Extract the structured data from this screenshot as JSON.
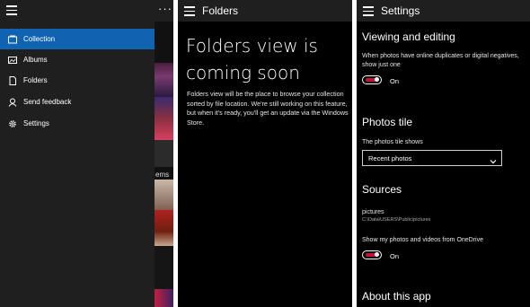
{
  "nav_panel": {
    "items": [
      {
        "label": "Collection",
        "icon": "collection-icon",
        "active": true
      },
      {
        "label": "Albums",
        "icon": "albums-icon",
        "active": false
      },
      {
        "label": "Folders",
        "icon": "folders-icon",
        "active": false
      },
      {
        "label": "Send feedback",
        "icon": "feedback-icon",
        "active": false
      },
      {
        "label": "Settings",
        "icon": "gear-icon",
        "active": false
      }
    ],
    "more_label": "···",
    "background_label": "ems",
    "accent_color": "#0f63b0"
  },
  "folders_panel": {
    "title": "Folders",
    "headline": "Folders view is coming soon",
    "description": "Folders view will be the place to browse your collection sorted by file location. We're still working on this feature, but when it's ready, you'll get an update via the Windows Store."
  },
  "settings_panel": {
    "title": "Settings",
    "viewing": {
      "heading": "Viewing and editing",
      "description": "When photos have online duplicates or digital negatives, show just one",
      "toggle_label": "On",
      "toggle_on": true
    },
    "tile": {
      "heading": "Photos tile",
      "label": "The photos tile shows",
      "selected": "Recent photos"
    },
    "sources": {
      "heading": "Sources",
      "folder_name": "pictures",
      "folder_path": "C:\\Data\\USERS\\Public\\pictures",
      "onedrive_label": "Show my photos and videos from OneDrive",
      "toggle_label": "On",
      "toggle_on": true
    },
    "about": {
      "heading": "About this app"
    },
    "toggle_color": "#c8102e"
  }
}
